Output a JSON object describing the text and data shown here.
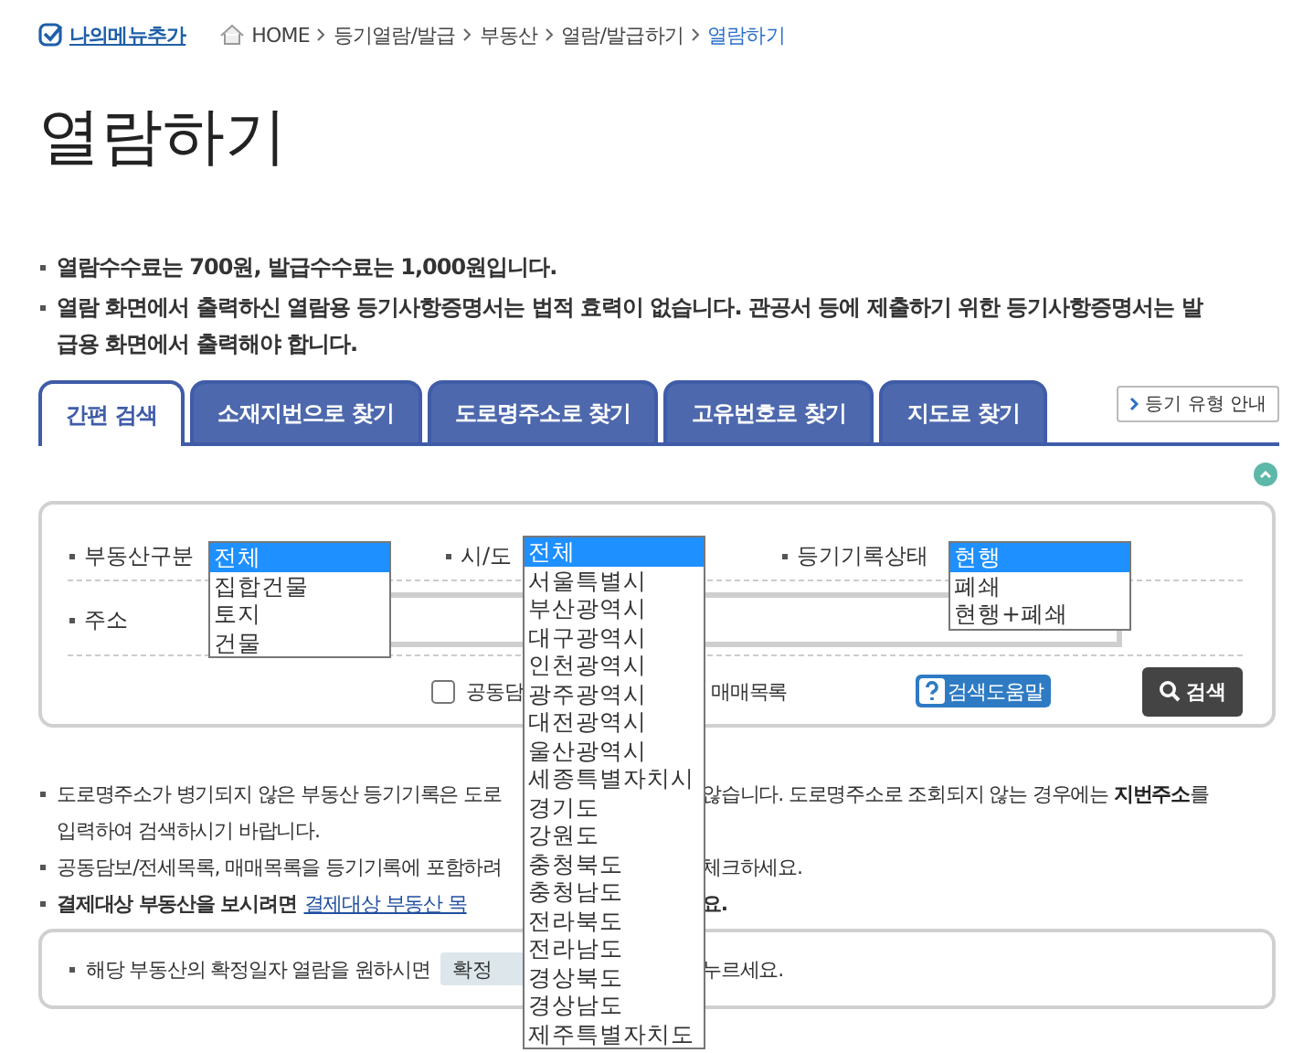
{
  "my_menu": "나의메뉴추가",
  "breadcrumb": [
    {
      "label": "HOME",
      "selected": false
    },
    {
      "label": "등기열람/발급",
      "selected": false
    },
    {
      "label": "부동산",
      "selected": false
    },
    {
      "label": "열람/발급하기",
      "selected": false
    },
    {
      "label": "열람하기",
      "selected": true
    }
  ],
  "title": "열람하기",
  "notes": [
    "열람수수료는 700원, 발급수수료는 1,000원입니다.",
    "열람 화면에서 출력하신 열람용 등기사항증명서는 법적 효력이 없습니다. 관공서 등에 제출하기 위한 등기사항증명서는 발급용 화면에서 출력해야 합니다."
  ],
  "tabs": [
    {
      "label": "간편 검색",
      "selected": true
    },
    {
      "label": "소재지번으로 찾기",
      "selected": false
    },
    {
      "label": "도로명주소로 찾기",
      "selected": false
    },
    {
      "label": "고유번호로 찾기",
      "selected": false
    },
    {
      "label": "지도로 찾기",
      "selected": false
    }
  ],
  "guide_button": "등기 유형 안내",
  "search_form": {
    "fields": [
      {
        "label": "부동산구분",
        "options": [
          {
            "label": "전체",
            "selected": true
          },
          {
            "label": "집합건물",
            "selected": false
          },
          {
            "label": "토지",
            "selected": false
          },
          {
            "label": "건물",
            "selected": false
          }
        ]
      },
      {
        "label": "시/도",
        "options": [
          {
            "label": "전체",
            "selected": true
          },
          {
            "label": "서울특별시",
            "selected": false
          },
          {
            "label": "부산광역시",
            "selected": false
          },
          {
            "label": "대구광역시",
            "selected": false
          },
          {
            "label": "인천광역시",
            "selected": false
          },
          {
            "label": "광주광역시",
            "selected": false
          },
          {
            "label": "대전광역시",
            "selected": false
          },
          {
            "label": "울산광역시",
            "selected": false
          },
          {
            "label": "세종특별자치시",
            "selected": false
          },
          {
            "label": "경기도",
            "selected": false
          },
          {
            "label": "강원도",
            "selected": false
          },
          {
            "label": "충청북도",
            "selected": false
          },
          {
            "label": "충청남도",
            "selected": false
          },
          {
            "label": "전라북도",
            "selected": false
          },
          {
            "label": "전라남도",
            "selected": false
          },
          {
            "label": "경상북도",
            "selected": false
          },
          {
            "label": "경상남도",
            "selected": false
          },
          {
            "label": "제주특별자치도",
            "selected": false
          }
        ]
      },
      {
        "label": "등기기록상태",
        "options": [
          {
            "label": "현행",
            "selected": true
          },
          {
            "label": "폐쇄",
            "selected": false
          },
          {
            "label": "현행+폐쇄",
            "selected": false
          }
        ]
      }
    ],
    "address_label": "주소",
    "checkbox": {
      "label": "공동담",
      "checked": false
    },
    "after_checkbox": "매매목록",
    "help_button": "검색도움말",
    "search_button": "검색"
  },
  "bottom_notes": [
    {
      "kind": "split",
      "left": "도로명주소가 병기되지 않은 부동산 등기기록은 도로",
      "right": "않습니다. 도로명주소로 조회되지 않는 경우에는 **지번주소**를"
    },
    {
      "kind": "continuation",
      "left": "입력하여 검색하시기 바랍니다."
    },
    {
      "kind": "split",
      "left": "공동담보/전세목록, 매매목록을 등기기록에 포함하려",
      "right": "체크하세요."
    },
    {
      "kind": "link",
      "left": "결제대상 부동산을 보시려면",
      "link": "결제대상 부동산 목",
      "right": "요."
    }
  ],
  "info_box": {
    "text": "해당 부동산의 확정일자 열람을 원하시면",
    "button": "확정",
    "after": "누르세요."
  }
}
